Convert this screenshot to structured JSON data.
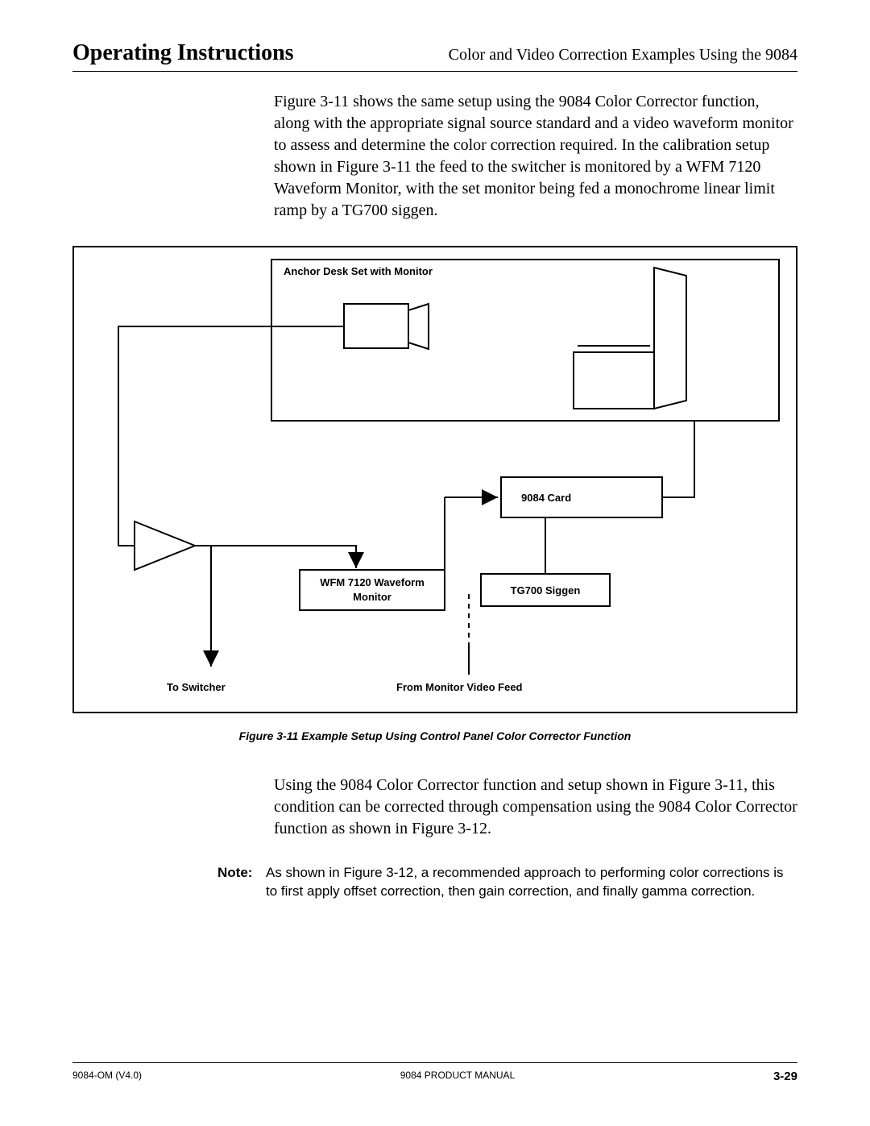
{
  "header": {
    "left": "Operating Instructions",
    "right": "Color and Video Correction Examples Using the 9084"
  },
  "para1": "Figure 3-11 shows the same setup using the 9084 Color Corrector function, along with the appropriate signal source standard and a video waveform monitor to assess and determine the color correction required. In the calibration setup shown in Figure 3-11 the feed to the switcher is monitored by a WFM 7120 Waveform Monitor, with the set monitor being fed a monochrome linear limit ramp by a TG700 siggen.",
  "diagram": {
    "anchor_desk": "Anchor Desk Set with Monitor",
    "card": "9084 Card",
    "wfm_line1": "WFM 7120 Waveform",
    "wfm_line2": "Monitor",
    "siggen": "TG700 Siggen",
    "to_switcher": "To Switcher",
    "from_monitor": "From Monitor Video Feed"
  },
  "caption": "Figure 3-11  Example Setup Using Control Panel Color Corrector Function",
  "para2": "Using the 9084 Color Corrector function and setup shown in Figure 3-11, this condition can be corrected through compensation using the 9084 Color Corrector function as shown in Figure 3-12.",
  "note": {
    "label": "Note:",
    "text": "As shown in Figure 3-12, a recommended approach to performing color corrections is to first apply offset correction, then gain correction, and finally gamma correction."
  },
  "footer": {
    "left": "9084-OM  (V4.0)",
    "center": "9084 PRODUCT MANUAL",
    "right": "3-29"
  }
}
